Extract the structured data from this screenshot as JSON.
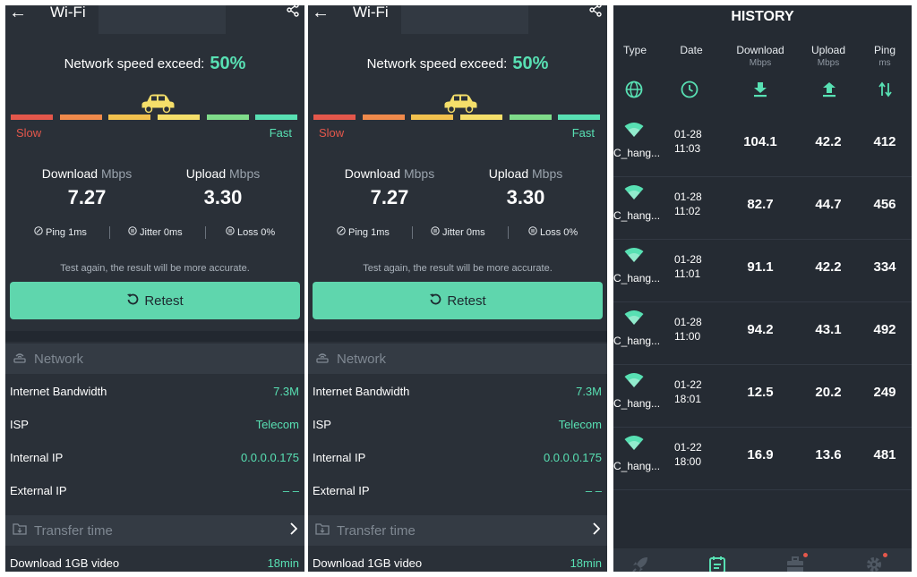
{
  "result_screens": [
    {
      "title": "Wi-Fi",
      "exceed_label": "Network speed exceed:",
      "exceed_value": "50%",
      "progress_fraction": 0.5,
      "speed_scale": {
        "slow": "Slow",
        "fast": "Fast"
      },
      "download": {
        "label": "Download",
        "unit": "Mbps",
        "value": "7.27"
      },
      "upload": {
        "label": "Upload",
        "unit": "Mbps",
        "value": "3.30"
      },
      "stats": {
        "ping": "Ping 1ms",
        "jitter": "Jitter 0ms",
        "loss": "Loss 0%"
      },
      "hint": "Test again, the result will be more accurate.",
      "retest_label": "Retest",
      "network_section": {
        "title": "Network",
        "rows": [
          {
            "label": "Internet Bandwidth",
            "value": "7.3M"
          },
          {
            "label": "ISP",
            "value": "Telecom"
          },
          {
            "label": "Internal IP",
            "value": "0.0.0.0.175"
          },
          {
            "label": "External IP",
            "value": "– –"
          }
        ]
      },
      "transfer_section": {
        "title": "Transfer time",
        "rows": [
          {
            "label": "Download 1GB video",
            "value": "18min"
          }
        ]
      }
    },
    {
      "title": "Wi-Fi",
      "exceed_label": "Network speed exceed:",
      "exceed_value": "50%",
      "progress_fraction": 0.5,
      "speed_scale": {
        "slow": "Slow",
        "fast": "Fast"
      },
      "download": {
        "label": "Download",
        "unit": "Mbps",
        "value": "7.27"
      },
      "upload": {
        "label": "Upload",
        "unit": "Mbps",
        "value": "3.30"
      },
      "stats": {
        "ping": "Ping 1ms",
        "jitter": "Jitter 0ms",
        "loss": "Loss 0%"
      },
      "hint": "Test again, the result will be more accurate.",
      "retest_label": "Retest",
      "network_section": {
        "title": "Network",
        "rows": [
          {
            "label": "Internet Bandwidth",
            "value": "7.3M"
          },
          {
            "label": "ISP",
            "value": "Telecom"
          },
          {
            "label": "Internal IP",
            "value": "0.0.0.0.175"
          },
          {
            "label": "External IP",
            "value": "– –"
          }
        ]
      },
      "transfer_section": {
        "title": "Transfer time",
        "rows": [
          {
            "label": "Download 1GB video",
            "value": "18min"
          }
        ]
      }
    }
  ],
  "colors": {
    "accent": "#58e0b3",
    "slow": "#e4574b",
    "bar_segments": [
      "#e4574b",
      "#f08a4b",
      "#f2c14e",
      "#f5df6a",
      "#7fdc8a",
      "#58e0b3"
    ],
    "background": "#2a3038"
  },
  "history": {
    "title": "HISTORY",
    "columns": [
      {
        "label": "Type",
        "unit": "",
        "icon": "globe-icon"
      },
      {
        "label": "Date",
        "unit": "",
        "icon": "clock-icon"
      },
      {
        "label": "Download",
        "unit": "Mbps",
        "icon": "download-arrow-icon"
      },
      {
        "label": "Upload",
        "unit": "Mbps",
        "icon": "upload-arrow-icon"
      },
      {
        "label": "Ping",
        "unit": "ms",
        "icon": "ping-arrows-icon"
      }
    ],
    "rows": [
      {
        "ssid": "C_hang...",
        "date": "01-28",
        "time": "11:03",
        "download": "104.1",
        "upload": "42.2",
        "ping": "412"
      },
      {
        "ssid": "C_hang...",
        "date": "01-28",
        "time": "11:02",
        "download": "82.7",
        "upload": "44.7",
        "ping": "456"
      },
      {
        "ssid": "C_hang...",
        "date": "01-28",
        "time": "11:01",
        "download": "91.1",
        "upload": "42.2",
        "ping": "334"
      },
      {
        "ssid": "C_hang...",
        "date": "01-28",
        "time": "11:00",
        "download": "94.2",
        "upload": "43.1",
        "ping": "492"
      },
      {
        "ssid": "C_hang...",
        "date": "01-22",
        "time": "18:01",
        "download": "12.5",
        "upload": "20.2",
        "ping": "249"
      },
      {
        "ssid": "C_hang...",
        "date": "01-22",
        "time": "18:00",
        "download": "16.9",
        "upload": "13.6",
        "ping": "481"
      }
    ],
    "bottom_nav": [
      {
        "icon": "rocket-icon"
      },
      {
        "icon": "history-list-icon"
      },
      {
        "icon": "toolbox-icon"
      },
      {
        "icon": "settings-gear-icon"
      }
    ]
  }
}
